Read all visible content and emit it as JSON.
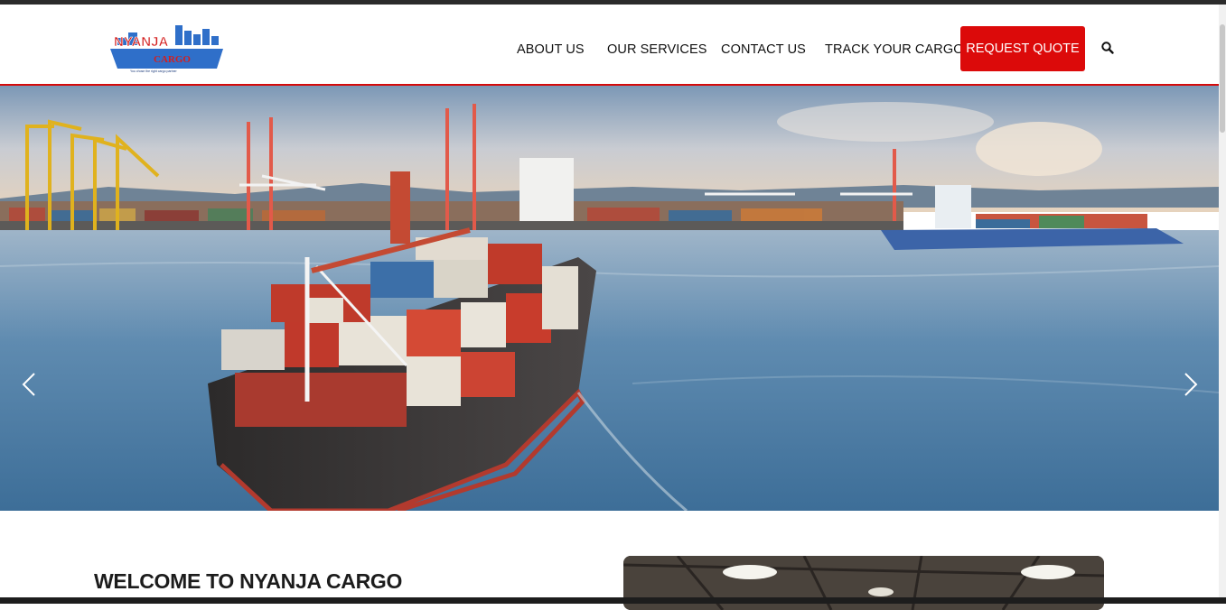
{
  "brand": {
    "logo_main": "NYANJA",
    "logo_sub": "CARGO",
    "tagline": "You chose the right cargo partner"
  },
  "nav": {
    "about": "ABOUT US",
    "services": "OUR SERVICES",
    "contact": "CONTACT US",
    "track": "TRACK YOUR CARGO",
    "quote": "REQUEST QUOTE",
    "search_icon": "search-icon"
  },
  "colors": {
    "accent": "#dc0a0a",
    "logo_blue": "#2f6fc9",
    "logo_red": "#d41f1f"
  },
  "hero": {
    "slide_prev_icon": "chevron-left-icon",
    "slide_next_icon": "chevron-right-icon"
  },
  "welcome": {
    "title": "WELCOME TO NYANJA CARGO"
  }
}
